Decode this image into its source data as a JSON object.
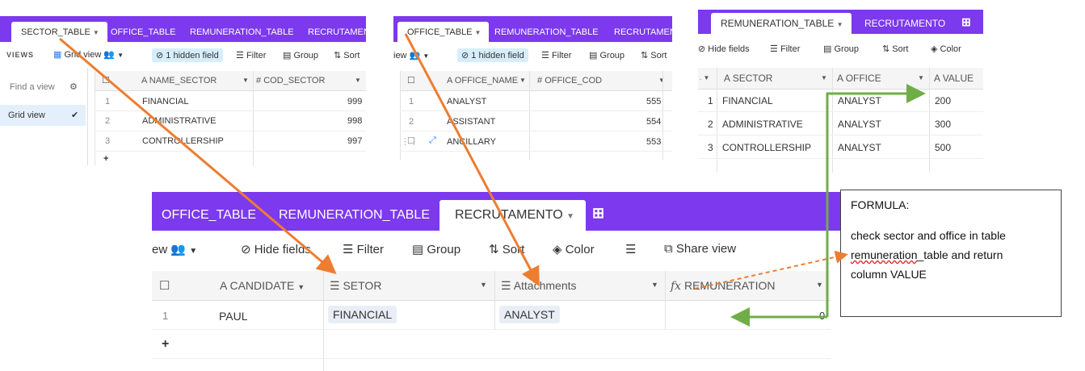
{
  "sector_panel": {
    "tabs": [
      "SECTOR_TABLE",
      "OFFICE_TABLE",
      "REMUNERATION_TABLE",
      "RECRUTAMENT"
    ],
    "views_label": "VIEWS",
    "grid_view": "Grid view",
    "hidden_field": "1 hidden field",
    "filter": "Filter",
    "group": "Group",
    "sort": "Sort",
    "find_view": "Find a view",
    "grid_view_item": "Grid view",
    "columns": [
      "NAME_SECTOR",
      "COD_SECTOR"
    ],
    "rows": [
      {
        "n": "1",
        "name": "FINANCIAL",
        "code": "999"
      },
      {
        "n": "2",
        "name": "ADMINISTRATIVE",
        "code": "998"
      },
      {
        "n": "3",
        "name": "CONTROLLERSHIP",
        "code": "997"
      }
    ],
    "add": "+"
  },
  "office_panel": {
    "tabs": [
      "OFFICE_TABLE",
      "REMUNERATION_TABLE",
      "RECRUTAMEN"
    ],
    "view_label": "iew",
    "hidden_field": "1 hidden field",
    "filter": "Filter",
    "group": "Group",
    "sort": "Sort",
    "columns": [
      "OFFICE_NAME",
      "OFFICE_COD"
    ],
    "rows": [
      {
        "n": "1",
        "name": "ANALYST",
        "code": "555"
      },
      {
        "n": "2",
        "name": "ASSISTANT",
        "code": "554"
      },
      {
        "n": "",
        "name": "ANCILLARY",
        "code": "553"
      }
    ]
  },
  "remun_panel": {
    "tabs": [
      "REMUNERATION_TABLE",
      "RECRUTAMENTO"
    ],
    "hide_fields": "Hide fields",
    "filter": "Filter",
    "group": "Group",
    "sort": "Sort",
    "color": "Color",
    "columns": [
      "SECTOR",
      "OFFICE",
      "VALUE"
    ],
    "rows": [
      {
        "n": "1",
        "sector": "FINANCIAL",
        "office": "ANALYST",
        "value": "200"
      },
      {
        "n": "2",
        "sector": "ADMINISTRATIVE",
        "office": "ANALYST",
        "value": "300"
      },
      {
        "n": "3",
        "sector": "CONTROLLERSHIP",
        "office": "ANALYST",
        "value": "500"
      }
    ]
  },
  "recrut_panel": {
    "tabs": [
      "OFFICE_TABLE",
      "REMUNERATION_TABLE",
      "RECRUTAMENTO"
    ],
    "view_label": "ew",
    "hide_fields": "Hide fields",
    "filter": "Filter",
    "group": "Group",
    "sort": "Sort",
    "color": "Color",
    "share_view": "Share view",
    "columns": [
      "CANDIDATE",
      "SETOR",
      "Attachments",
      "REMUNERATION"
    ],
    "row": {
      "n": "1",
      "candidate": "PAUL",
      "setor": "FINANCIAL",
      "attachment": "ANALYST",
      "remuneration": "0"
    },
    "add": "+"
  },
  "formula_box": {
    "title": "FORMULA:",
    "line1": "check sector and office in table",
    "line2a": "remuneration",
    "line2b": "_table",
    "line2c": " and return",
    "line3": "column VALUE"
  },
  "colors": {
    "tabbar": "#7c39ed",
    "orange_arrow": "#ed7d31",
    "green_arrow": "#70ad47",
    "pill": "#d6eefb"
  }
}
